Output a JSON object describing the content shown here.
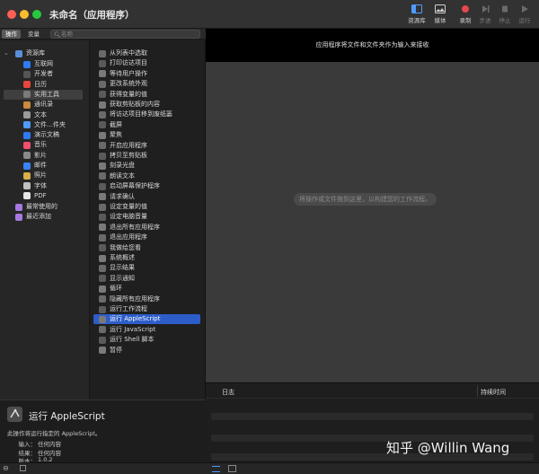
{
  "window": {
    "title": "未命名（应用程序）"
  },
  "toolbar": {
    "library": "资源库",
    "media": "媒体",
    "record": "录制",
    "step": "步进",
    "stop": "停止",
    "run": "运行"
  },
  "tabs": {
    "actions": "操作",
    "variables": "变量"
  },
  "search": {
    "placeholder": "名称"
  },
  "library": {
    "root": "资源库",
    "categories": [
      "互联网",
      "开发者",
      "日历",
      "实用工具",
      "通讯录",
      "文本",
      "文件…件夹",
      "演示文稿",
      "音乐",
      "影片",
      "邮件",
      "照片",
      "字体",
      "PDF"
    ],
    "selected_index": 3,
    "most_used": "最常使用的",
    "recent": "最近添加"
  },
  "actions": {
    "items": [
      "从列表中选取",
      "打印访达项目",
      "等待用户操作",
      "更改系统外观",
      "获得变量的值",
      "获取剪贴板的内容",
      "将访达项目移到废纸篓",
      "截屏",
      "聚焦",
      "开启应用程序",
      "拷贝至剪贴板",
      "刻录光盘",
      "朗读文本",
      "启动屏幕保护程序",
      "请求确认",
      "设定变量的值",
      "设定电脑音量",
      "退出所有应用程序",
      "退出应用程序",
      "我做给您看",
      "系统概述",
      "显示结果",
      "显示通知",
      "循环",
      "隐藏所有应用程序",
      "运行工作流程",
      "运行 AppleScript",
      "运行 JavaScript",
      "运行 Shell 脚本",
      "暂停"
    ],
    "selected_index": 26
  },
  "description": {
    "title": "运行 AppleScript",
    "summary": "此操作将运行指定的 AppleScript。",
    "input_label": "输入：",
    "input_value": "任何内容",
    "result_label": "结果：",
    "result_value": "任何内容",
    "version_label": "版本：",
    "version_value": "1.0.2"
  },
  "workflow": {
    "header_hint": "应用程序将文件和文件夹作为输入来接收",
    "drop_hint": "将操作或文件拖到这里，以构建您的工作流程。"
  },
  "log": {
    "col_log": "日志",
    "col_duration": "持续时间"
  },
  "watermark": "知乎 @Willin Wang",
  "colors": {
    "selection": "#2d5dc9",
    "canvas": "#3a3a3a",
    "record": "#e5484d"
  }
}
